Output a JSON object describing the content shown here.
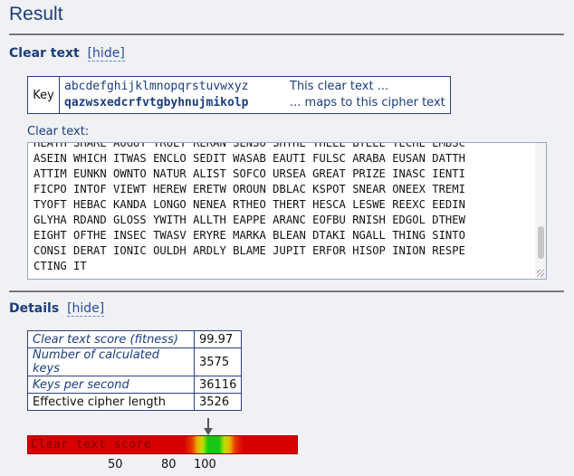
{
  "result_title": "Result",
  "clear_text_section": {
    "heading": "Clear text",
    "toggle": "[hide]",
    "key": {
      "label": "Key",
      "plain_alphabet": "abcdefghijklmnopqrstuvwxyz",
      "cipher_alphabet": "qazwsxedcrfvtgbyhnujmikolp",
      "plain_note": "This clear text ...",
      "cipher_note": "... maps to this cipher text"
    },
    "clear_text_label": "Clear text:",
    "clear_text_lines": [
      "HEATH SHARE AUGUT TRUEY RERAN SENSO SHTHE THEEE BTEEE TECHE EMBSC",
      "ASEIN WHICH ITWAS ENCLO SEDIT WASAB EAUTI FULSC ARABA EUSAN DATTH",
      "ATTIM EUNKN OWNTO NATUR ALIST SOFCO URSEA GREAT PRIZE INASC IENTI",
      "FICPO INTOF VIEWT HEREW ERETW OROUN DBLAC KSPOT SNEAR ONEEX TREMI",
      "TYOFT HEBAC KANDA LONGO NENEA RTHEO THERT HESCA LESWE REEXC EEDIN",
      "GLYHA RDAND GLOSS YWITH ALLTH EAPPE ARANC EOFBU RNISH EDGOL DTHEW",
      "EIGHT OFTHE INSEC TWASV ERYRE MARKA BLEAN DTAKI NGALL THING SINTO",
      "CONSI DERAT IONIC OULDH ARDLY BLAME JUPIT ERFOR HISOP INION RESPE",
      "CTING IT"
    ]
  },
  "details_section": {
    "heading": "Details",
    "toggle": "[hide]",
    "rows": [
      {
        "label": "Clear text score (fitness)",
        "value": "99.97"
      },
      {
        "label": "Number of calculated keys",
        "value": "3575"
      },
      {
        "label": "Keys per second",
        "value": "36116"
      },
      {
        "label": "Effective cipher length",
        "value": "3526"
      }
    ]
  },
  "score_meter": {
    "label": "Clear text score",
    "score": 99.97,
    "ticks": [
      "50",
      "80",
      "100"
    ],
    "colors": {
      "low": "#d80000",
      "mid": "#f0b000",
      "high": "#14c814"
    }
  }
}
